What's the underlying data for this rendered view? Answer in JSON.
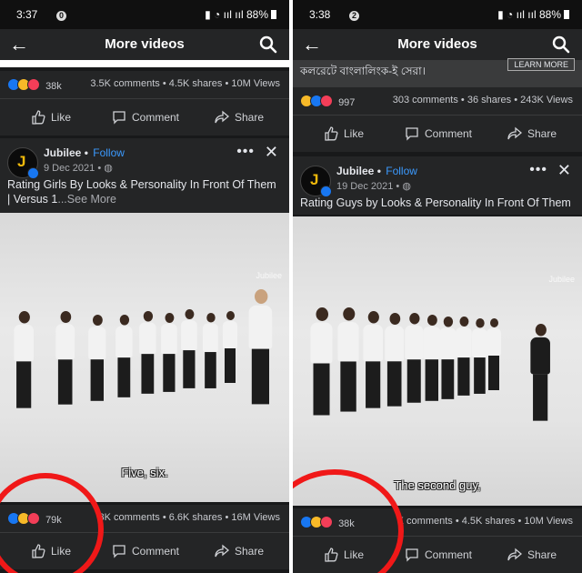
{
  "left": {
    "status": {
      "time": "3:37",
      "notif": "0",
      "battery": "88%"
    },
    "topbar": {
      "title": "More videos"
    },
    "prev": {
      "reaction_count": "38k",
      "stats": "3.5K comments • 4.5K shares • 10M Views"
    },
    "actions": {
      "like": "Like",
      "comment": "Comment",
      "share": "Share"
    },
    "post": {
      "author": "Jubilee",
      "follow": "Follow",
      "date": "9 Dec 2021 •",
      "title": "Rating Girls By Looks & Personality In Front Of Them | Versus 1",
      "see_more": "...See More",
      "watermark": "Jubilee",
      "subtitle": "Five, six.",
      "reaction_count": "79k",
      "stats": "8K comments • 6.6K shares • 16M Views"
    }
  },
  "right": {
    "status": {
      "time": "3:38",
      "notif": "2",
      "battery": "88%"
    },
    "topbar": {
      "title": "More videos"
    },
    "banner": {
      "text": "কলরেটে বাংলালিংক-ই সেরা।",
      "cta": "LEARN MORE"
    },
    "prev": {
      "reaction_count": "997",
      "stats": "303 comments • 36 shares • 243K Views"
    },
    "actions": {
      "like": "Like",
      "comment": "Comment",
      "share": "Share"
    },
    "post": {
      "author": "Jubilee",
      "follow": "Follow",
      "date": "19 Dec 2021 •",
      "title": "Rating Guys by Looks & Personality In Front Of Them",
      "watermark": "Jubilee",
      "subtitle": "The second guy,",
      "reaction_count": "38k",
      "stats": "K comments • 4.5K shares • 10M Views"
    }
  },
  "colors": {
    "accent": "#1877f2",
    "follow": "#3b9aff",
    "annotation": "#f01818",
    "panel_bg": "#242526"
  },
  "icons": [
    "back-arrow-icon",
    "search-icon",
    "like-icon",
    "comment-icon",
    "share-icon",
    "globe-icon",
    "more-icon",
    "close-icon",
    "verified-badge-icon"
  ]
}
